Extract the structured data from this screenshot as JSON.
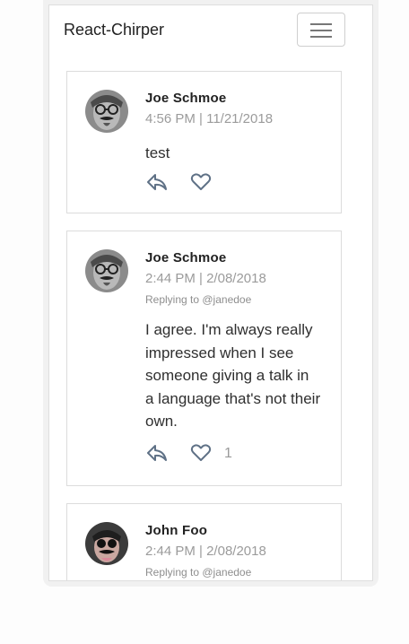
{
  "navbar": {
    "brand": "React-Chirper"
  },
  "tweets": [
    {
      "author": "Joe Schmoe",
      "timestamp": "4:56 PM | 11/21/2018",
      "replying_to": "",
      "text": "test",
      "likes": ""
    },
    {
      "author": "Joe Schmoe",
      "timestamp": "2:44 PM | 2/08/2018",
      "replying_to": "Replying to @janedoe",
      "text_lines": [
        "I agree. I'm always really",
        "impressed when I see",
        "someone giving a talk in",
        "a language that's not their",
        "own."
      ],
      "likes": "1"
    },
    {
      "author": "John Foo",
      "timestamp": "2:44 PM | 2/08/2018",
      "replying_to": "Replying to @janedoe"
    }
  ],
  "icons": {
    "menu": "hamburger-icon",
    "reply": "reply-arrow-icon",
    "like": "heart-outline-icon"
  },
  "colors": {
    "icon": "#5f7186",
    "muted": "#9b9b9b",
    "border": "#dcdcdc"
  }
}
